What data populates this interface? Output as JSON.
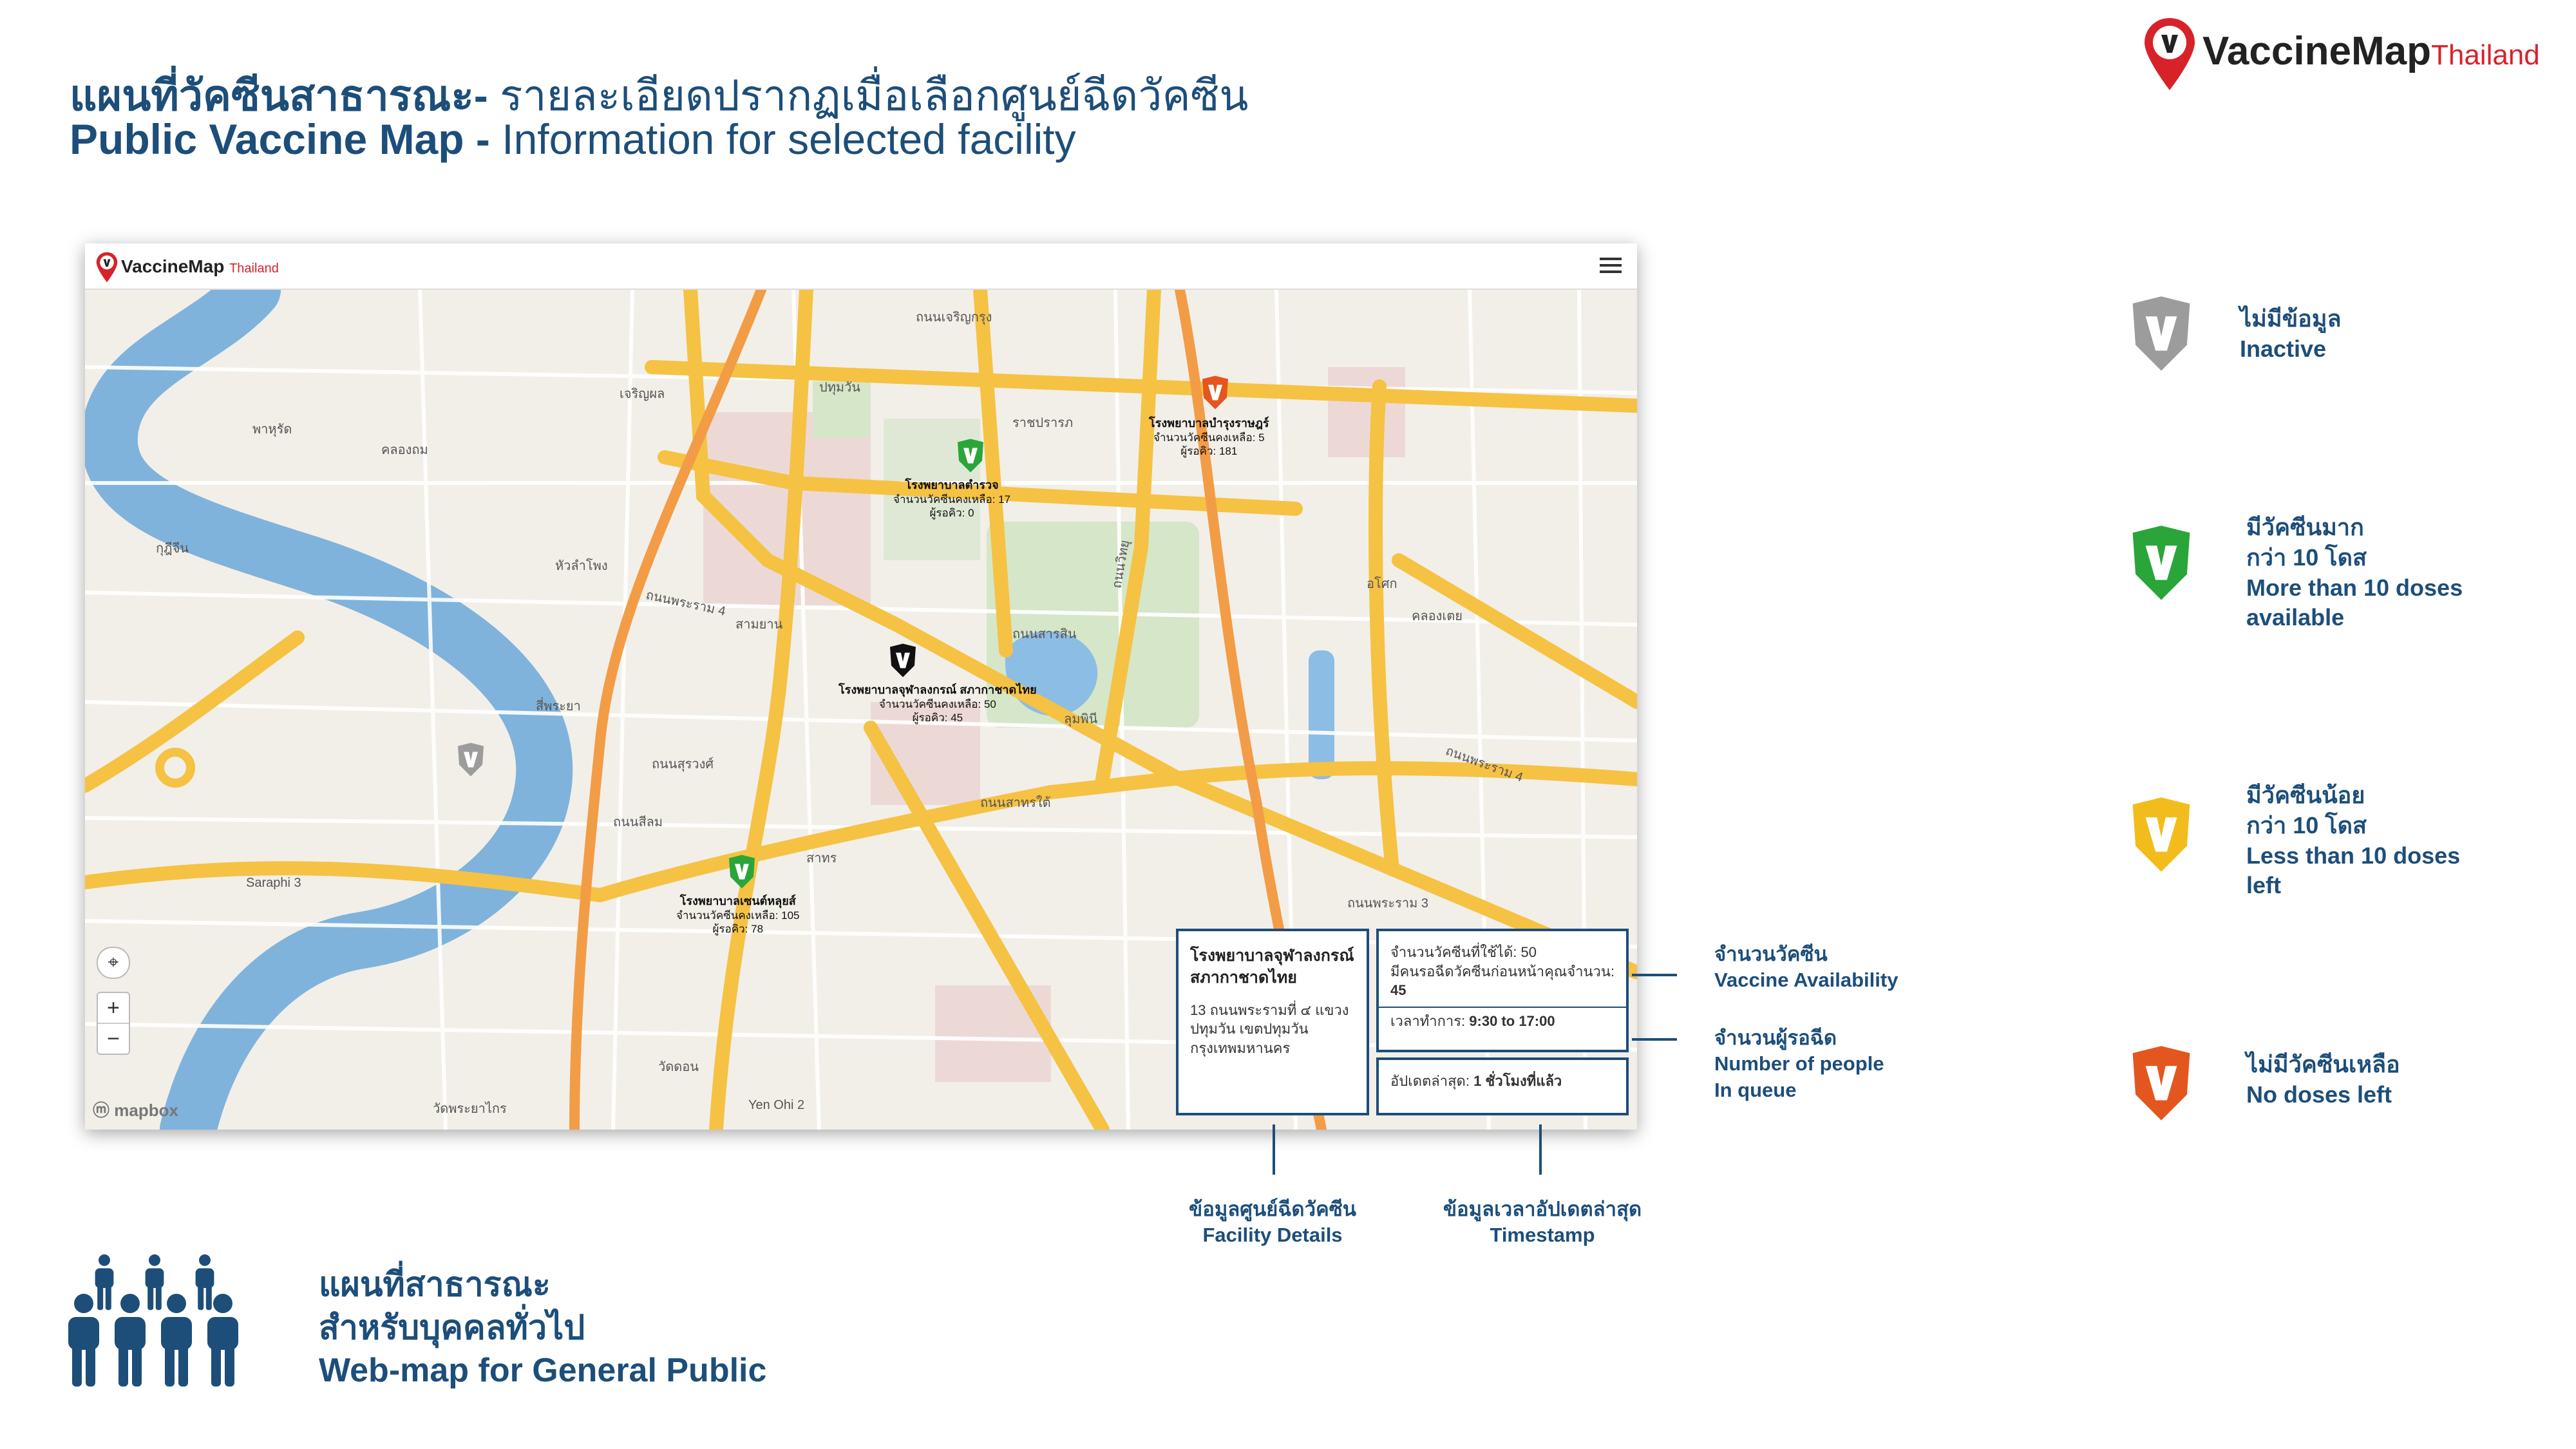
{
  "header": {
    "title_th_bold": "แผนที่วัคซีนสาธารณะ-",
    "title_th_regular": " รายละเอียดปรากฏเมื่อเลือกศูนย์ฉีดวัคซีน",
    "title_en_bold": "Public Vaccine Map -",
    "title_en_regular": " Information for selected facility"
  },
  "brand": {
    "name": "VaccineMap",
    "country": "Thailand"
  },
  "app": {
    "logo_name": "VaccineMap",
    "logo_country": "Thailand",
    "menu_icon": "hamburger-icon",
    "attribution": "mapbox"
  },
  "map": {
    "labels": [
      {
        "text": "เจริญผล"
      },
      {
        "text": "ปทุมวัน"
      },
      {
        "text": "ราชปรารภ"
      },
      {
        "text": "พาหุรัด"
      },
      {
        "text": "คลองถม"
      },
      {
        "text": "กุฎีจีน"
      },
      {
        "text": "หัวลำโพง"
      },
      {
        "text": "ถนนพระราม 4"
      },
      {
        "text": "สามยาน"
      },
      {
        "text": "สี่พระยา"
      },
      {
        "text": "ถนนสุรวงศ์"
      },
      {
        "text": "ถนนสีลม"
      },
      {
        "text": "สาทร"
      },
      {
        "text": "ถนนสาทรใต้"
      },
      {
        "text": "Saraphi 3"
      },
      {
        "text": "วัดดอน"
      },
      {
        "text": "วัดพระยาไกร"
      },
      {
        "text": "Yen Ohi 2"
      },
      {
        "text": "อโศก"
      },
      {
        "text": "ลุมพินี"
      },
      {
        "text": "ถนนพระราม 4"
      },
      {
        "text": "ถนนสารสิน"
      },
      {
        "text": "ถนนวิทยุ"
      },
      {
        "text": "คลองเตย"
      },
      {
        "text": "ถนนเจริญกรุง"
      },
      {
        "text": "ถนนพระราม 3"
      }
    ],
    "facilities": [
      {
        "name": "โรงพยาบาลตำรวจ",
        "remaining": "จำนวนวัคซีนคงเหลือ: 17",
        "queue": "ผู้รอคิว: 0",
        "status": "green"
      },
      {
        "name": "โรงพยาบาลบำรุงราษฎร์",
        "remaining": "จำนวนวัคซีนคงเหลือ: 5",
        "queue": "ผู้รอคิว: 181",
        "status": "orange"
      },
      {
        "name": "โรงพยาบาลจุฬาลงกรณ์ สภากาชาดไทย",
        "remaining": "จำนวนวัคซีนคงเหลือ: 50",
        "queue": "ผู้รอคิว: 45",
        "status": "selected"
      },
      {
        "name": "โรงพยาบาลเซนต์หลุยส์",
        "remaining": "จำนวนวัคซีนคงเหลือ: 105",
        "queue": "ผู้รอคิว: 78",
        "status": "green"
      },
      {
        "name": "",
        "remaining": "",
        "queue": "",
        "status": "gray"
      }
    ]
  },
  "popup": {
    "facility_name_line1": "โรงพยาบาลจุฬาลงกรณ์",
    "facility_name_line2": "สภากาชาดไทย",
    "address_line1": "13 ถนนพระรามที่ ๔ แขวง",
    "address_line2": "ปทุมวัน เขตปทุมวัน",
    "address_line3": "กรุงเทพมหานคร",
    "available_label": "จำนวนวัคซีนที่ใช้ได้:",
    "available_value": "50",
    "queue_label": "มีคนรอฉีดวัคซีนก่อนหน้าคุณจำนวน:",
    "queue_value": "45",
    "hours_label": "เวลาทำการ:",
    "hours_value": "9:30 to 17:00",
    "updated_label": "อัปเดตล่าสุด:",
    "updated_value": "1 ชั่วโมงที่แล้ว"
  },
  "annotations": {
    "vaccine_th": "จำนวนวัคซีน",
    "vaccine_en": "Vaccine Availability",
    "queue_th": "จำนวนผู้รอฉีด",
    "queue_en1": "Number of people",
    "queue_en2": "In queue",
    "facility_th": "ข้อมูลศูนย์ฉีดวัคซีน",
    "facility_en": "Facility Details",
    "timestamp_th": "ข้อมูลเวลาอัปเดตล่าสุด",
    "timestamp_en": "Timestamp"
  },
  "legend": [
    {
      "th1": "ไม่มีข้อมูล",
      "th2": "",
      "en1": "Inactive",
      "en2": "",
      "color": "#9c9c9c"
    },
    {
      "th1": "มีวัคซีนมาก",
      "th2": "กว่า 10 โดส",
      "en1": "More than 10 doses",
      "en2": "available",
      "color": "#2aa53a"
    },
    {
      "th1": "มีวัคซีนน้อย",
      "th2": "กว่า 10 โดส",
      "en1": "Less than 10 doses",
      "en2": "left",
      "color": "#f2bd1c"
    },
    {
      "th1": "ไม่มีวัคซีนเหลือ",
      "th2": "",
      "en1": "No doses left",
      "en2": "",
      "color": "#e4561f"
    }
  ],
  "footer": {
    "line1": "แผนที่สาธารณะ",
    "line2": "สำหรับบุคคลทั่วไป",
    "line3": "Web-map for General Public"
  },
  "colors": {
    "primary": "#1d4e7a",
    "brand_red": "#d8222a",
    "road_major": "#f5c243",
    "road_orange": "#f39c46",
    "water": "#7fb3dc"
  }
}
